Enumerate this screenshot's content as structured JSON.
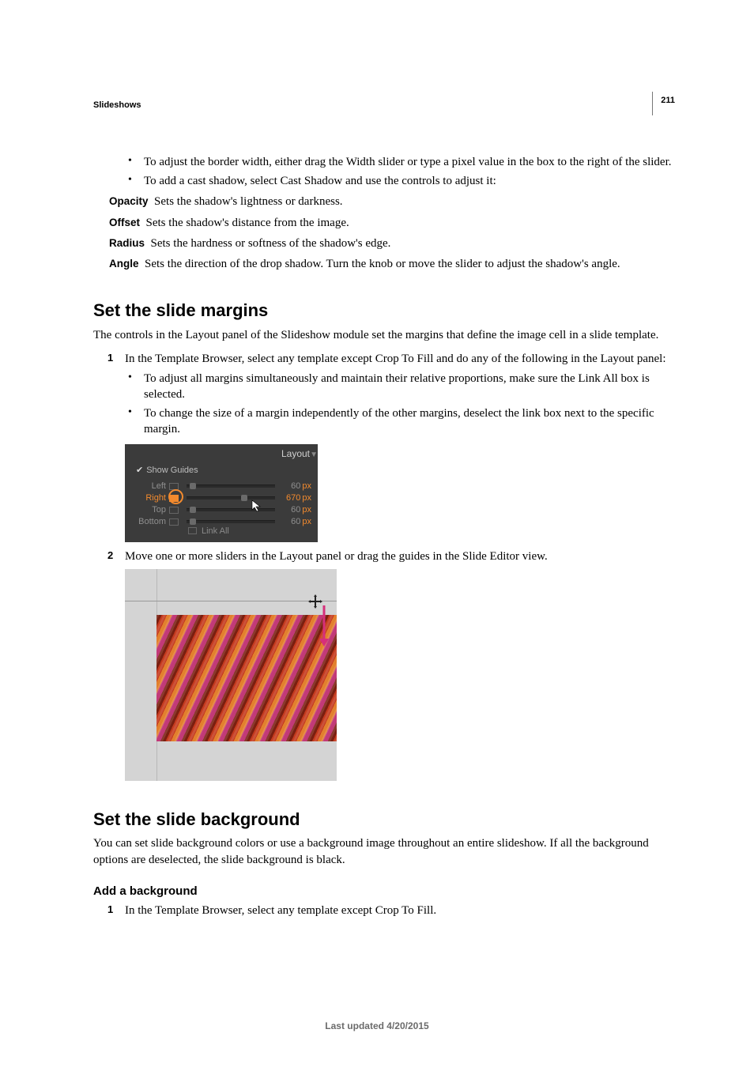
{
  "page": {
    "section": "Slideshows",
    "number": "211",
    "footer": "Last updated 4/20/2015"
  },
  "pre": {
    "bullets": [
      "To adjust the border width, either drag the Width slider or type a pixel value in the box to the right of the slider.",
      "To add a cast shadow, select Cast Shadow and use the controls to adjust it:"
    ],
    "defs": {
      "opacity": {
        "term": "Opacity",
        "def": "Sets the shadow's lightness or darkness."
      },
      "offset": {
        "term": "Offset",
        "def": "Sets the shadow's distance from the image."
      },
      "radius": {
        "term": "Radius",
        "def": "Sets the hardness or softness of the shadow's edge."
      },
      "angle": {
        "term": "Angle",
        "def": "Sets the direction of the drop shadow. Turn the knob or move the slider to adjust the shadow's angle."
      }
    }
  },
  "sec1": {
    "title": "Set the slide margins",
    "intro": "The controls in the Layout panel of the Slideshow module set the margins that define the image cell in a slide template.",
    "step1": {
      "num": "1",
      "text": "In the Template Browser, select any template except Crop To Fill and do any of the following in the Layout panel:"
    },
    "sub": [
      "To adjust all margins simultaneously and maintain their relative proportions, make sure the Link All box is selected.",
      "To change the size of a margin independently of the other margins, deselect the link box next to the specific margin."
    ],
    "panel": {
      "title": "Layout",
      "show_guides": "Show Guides",
      "rows": {
        "left": {
          "label": "Left",
          "value": "60",
          "unit": "px"
        },
        "right": {
          "label": "Right",
          "value": "670",
          "unit": "px"
        },
        "top": {
          "label": "Top",
          "value": "60",
          "unit": "px"
        },
        "bottom": {
          "label": "Bottom",
          "value": "60",
          "unit": "px"
        }
      },
      "link_all": "Link All"
    },
    "step2": {
      "num": "2",
      "text": "Move one or more sliders in the Layout panel or drag the guides in the Slide Editor view."
    }
  },
  "sec2": {
    "title": "Set the slide background",
    "intro": "You can set slide background colors or use a background image throughout an entire slideshow. If all the background options are deselected, the slide background is black.",
    "sub_title": "Add a background",
    "step1": {
      "num": "1",
      "text": "In the Template Browser, select any template except Crop To Fill."
    }
  }
}
